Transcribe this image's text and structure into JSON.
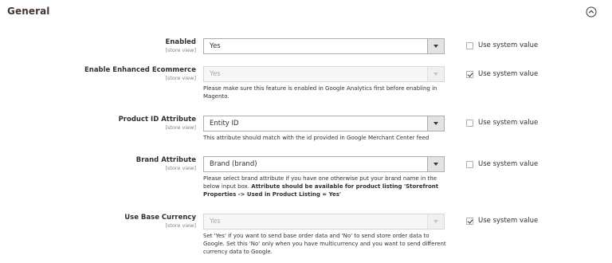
{
  "section": {
    "title": "General",
    "toggle_icon": "chevron-up-icon"
  },
  "fields": [
    {
      "label": "Enabled",
      "scope": "[store view]",
      "value": "Yes",
      "disabled": false,
      "use_system_value": false,
      "note": ""
    },
    {
      "label": "Enable Enhanced Ecommerce",
      "scope": "[store view]",
      "value": "Yes",
      "disabled": true,
      "use_system_value": true,
      "note": "Please make sure this feature is enabled in Google Analytics first before enabling in Magento."
    },
    {
      "label": "Product ID Attribute",
      "scope": "[store view]",
      "value": "Entity ID",
      "disabled": false,
      "use_system_value": false,
      "note": "This attribute should match with the id provided in Google Merchant Center feed"
    },
    {
      "label": "Brand Attribute",
      "scope": "[store view]",
      "value": "Brand (brand)",
      "disabled": false,
      "use_system_value": false,
      "note": "Please select brand attribute if you have one otherwise put your brand name in the below input box.",
      "note_bold": "Attribute should be available for product listing 'Storefront Properties -> Used in Product Listing = Yes'"
    },
    {
      "label": "Use Base Currency",
      "scope": "[store view]",
      "value": "Yes",
      "disabled": true,
      "use_system_value": true,
      "note": "Set 'Yes' if you want to send base order data and 'No' to send store order data to Google. Set this 'No' only when you have multicurrency and you want to send different currency data to Google."
    }
  ],
  "use_system_value_label": "Use system value"
}
